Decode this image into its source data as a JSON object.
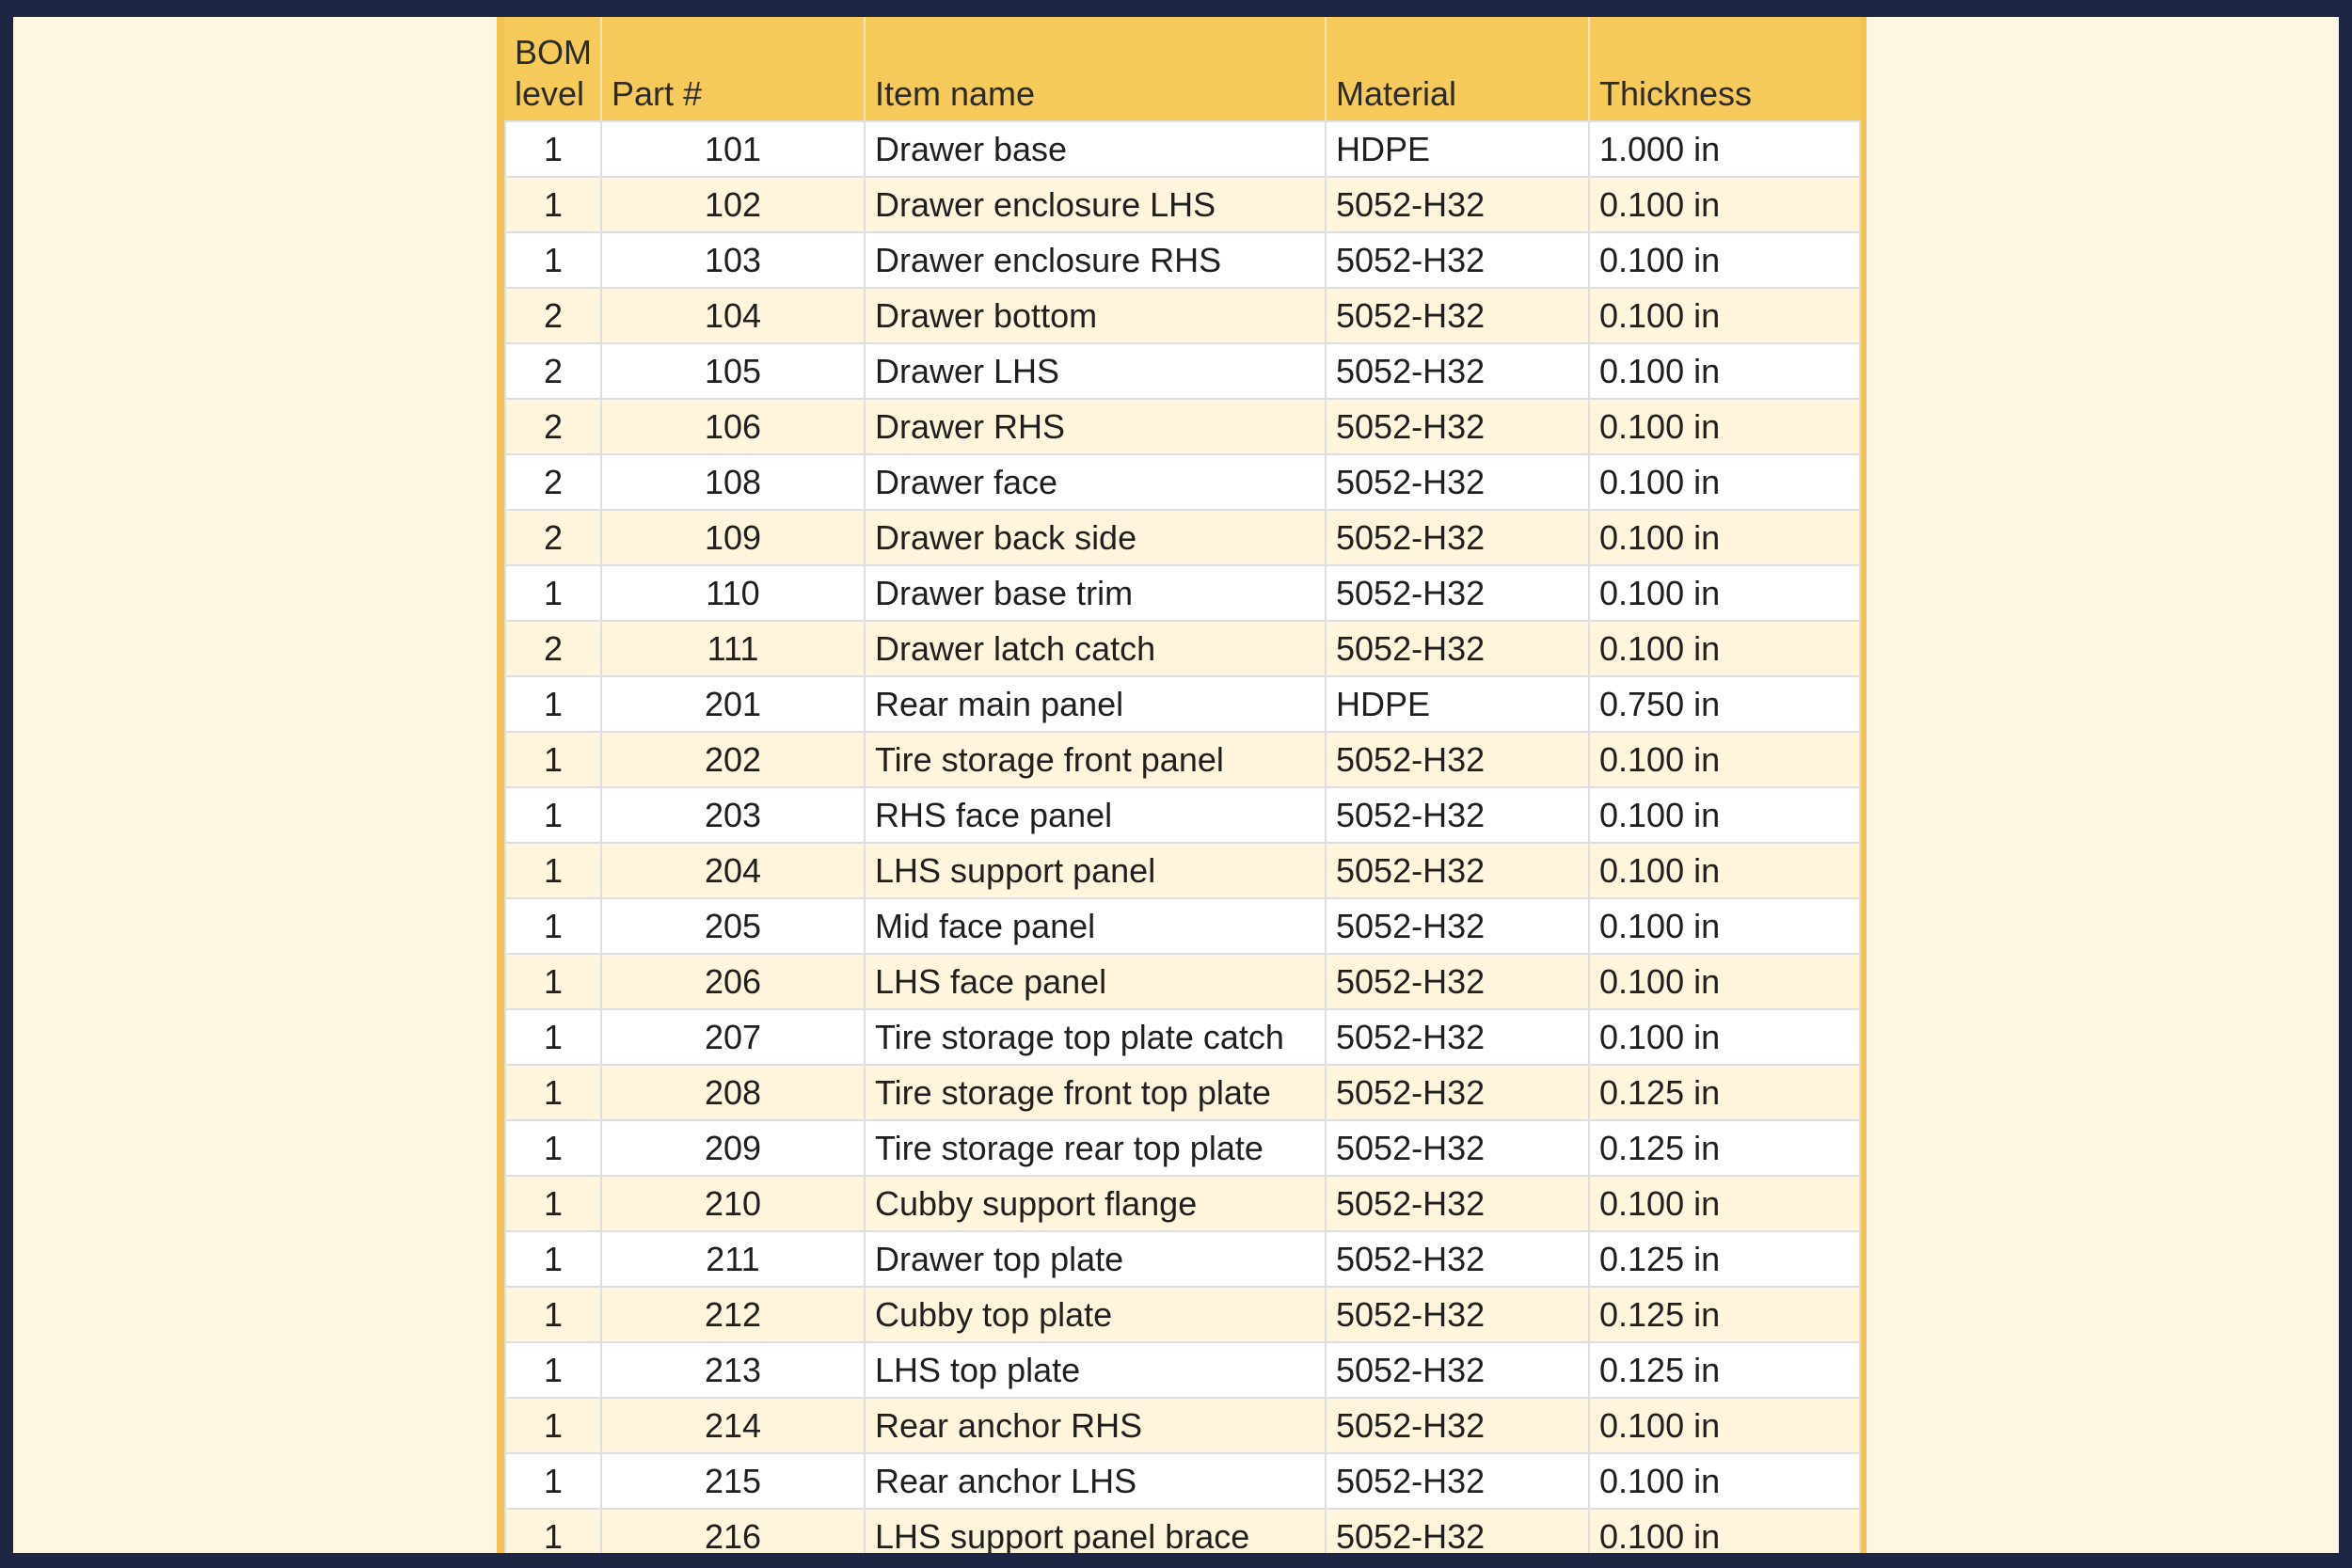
{
  "table": {
    "headers": {
      "level_line1": "BOM",
      "level_line2": "level",
      "part": "Part #",
      "item": "Item name",
      "material": "Material",
      "thickness": "Thickness"
    },
    "rows": [
      {
        "level": "1",
        "part": "101",
        "item": "Drawer base",
        "material": "HDPE",
        "thickness": "1.000 in"
      },
      {
        "level": "1",
        "part": "102",
        "item": "Drawer enclosure LHS",
        "material": "5052-H32",
        "thickness": "0.100 in"
      },
      {
        "level": "1",
        "part": "103",
        "item": "Drawer enclosure RHS",
        "material": "5052-H32",
        "thickness": "0.100 in"
      },
      {
        "level": "2",
        "part": "104",
        "item": "Drawer bottom",
        "material": "5052-H32",
        "thickness": "0.100 in"
      },
      {
        "level": "2",
        "part": "105",
        "item": "Drawer LHS",
        "material": "5052-H32",
        "thickness": "0.100 in"
      },
      {
        "level": "2",
        "part": "106",
        "item": "Drawer RHS",
        "material": "5052-H32",
        "thickness": "0.100 in"
      },
      {
        "level": "2",
        "part": "108",
        "item": "Drawer face",
        "material": "5052-H32",
        "thickness": "0.100 in"
      },
      {
        "level": "2",
        "part": "109",
        "item": "Drawer back side",
        "material": "5052-H32",
        "thickness": "0.100 in"
      },
      {
        "level": "1",
        "part": "110",
        "item": "Drawer base trim",
        "material": "5052-H32",
        "thickness": "0.100 in"
      },
      {
        "level": "2",
        "part": "111",
        "item": "Drawer latch catch",
        "material": "5052-H32",
        "thickness": "0.100 in"
      },
      {
        "level": "1",
        "part": "201",
        "item": "Rear main panel",
        "material": "HDPE",
        "thickness": "0.750 in"
      },
      {
        "level": "1",
        "part": "202",
        "item": "Tire storage front panel",
        "material": "5052-H32",
        "thickness": "0.100 in"
      },
      {
        "level": "1",
        "part": "203",
        "item": "RHS face panel",
        "material": "5052-H32",
        "thickness": "0.100 in"
      },
      {
        "level": "1",
        "part": "204",
        "item": "LHS support panel",
        "material": "5052-H32",
        "thickness": "0.100 in"
      },
      {
        "level": "1",
        "part": "205",
        "item": "Mid face panel",
        "material": "5052-H32",
        "thickness": "0.100 in"
      },
      {
        "level": "1",
        "part": "206",
        "item": "LHS face panel",
        "material": "5052-H32",
        "thickness": "0.100 in"
      },
      {
        "level": "1",
        "part": "207",
        "item": "Tire storage top plate catch",
        "material": "5052-H32",
        "thickness": "0.100 in"
      },
      {
        "level": "1",
        "part": "208",
        "item": "Tire storage front top plate",
        "material": "5052-H32",
        "thickness": "0.125 in"
      },
      {
        "level": "1",
        "part": "209",
        "item": "Tire storage rear top plate",
        "material": "5052-H32",
        "thickness": "0.125 in"
      },
      {
        "level": "1",
        "part": "210",
        "item": "Cubby support flange",
        "material": "5052-H32",
        "thickness": "0.100 in"
      },
      {
        "level": "1",
        "part": "211",
        "item": "Drawer top plate",
        "material": "5052-H32",
        "thickness": "0.125 in"
      },
      {
        "level": "1",
        "part": "212",
        "item": "Cubby top plate",
        "material": "5052-H32",
        "thickness": "0.125 in"
      },
      {
        "level": "1",
        "part": "213",
        "item": "LHS top plate",
        "material": "5052-H32",
        "thickness": "0.125 in"
      },
      {
        "level": "1",
        "part": "214",
        "item": "Rear anchor RHS",
        "material": "5052-H32",
        "thickness": "0.100 in"
      },
      {
        "level": "1",
        "part": "215",
        "item": "Rear anchor LHS",
        "material": "5052-H32",
        "thickness": "0.100 in"
      },
      {
        "level": "1",
        "part": "216",
        "item": "LHS support panel brace",
        "material": "5052-H32",
        "thickness": "0.100 in"
      }
    ]
  }
}
